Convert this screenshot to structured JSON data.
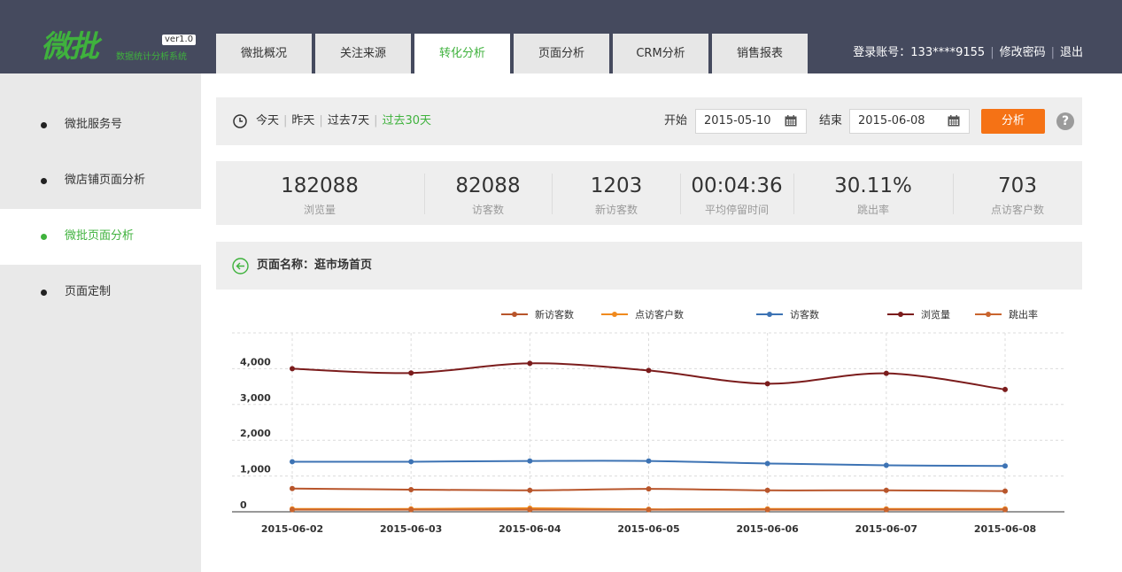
{
  "header": {
    "logo_text": "微批",
    "logo_version": "ver1.0",
    "logo_subtitle": "数据统计分析系统",
    "tabs": [
      {
        "label": "微批概况"
      },
      {
        "label": "关注来源"
      },
      {
        "label": "转化分析"
      },
      {
        "label": "页面分析"
      },
      {
        "label": "CRM分析"
      },
      {
        "label": "销售报表"
      }
    ],
    "active_tab": 2,
    "account_label": "登录账号：133****9155",
    "change_password": "修改密码",
    "logout": "退出"
  },
  "sidebar": {
    "items": [
      {
        "label": "微批服务号"
      },
      {
        "label": "微店铺页面分析"
      },
      {
        "label": "微批页面分析"
      },
      {
        "label": "页面定制"
      }
    ],
    "active_index": 2
  },
  "filter": {
    "clock_icon": "clock-icon",
    "ranges": [
      {
        "label": "今天"
      },
      {
        "label": "昨天"
      },
      {
        "label": "过去7天"
      },
      {
        "label": "过去30天"
      }
    ],
    "active_range": 3,
    "start_label": "开始",
    "start_date": "2015-05-10",
    "end_label": "结束",
    "end_date": "2015-06-08",
    "analyze_button": "分析",
    "help": "?"
  },
  "stats": [
    {
      "value": "182088",
      "label": "浏览量"
    },
    {
      "value": "82088",
      "label": "访客数"
    },
    {
      "value": "1203",
      "label": "新访客数"
    },
    {
      "value": "00:04:36",
      "label": "平均停留时间"
    },
    {
      "value": "30.11%",
      "label": "跳出率"
    },
    {
      "value": "703",
      "label": "点访客户数"
    }
  ],
  "page_bar": {
    "title": "页面名称：逛市场首页"
  },
  "colors": {
    "accent_green": "#3fb23d",
    "header_bg": "#454a5e",
    "analyze_orange": "#f57215"
  },
  "chart_data": {
    "type": "line",
    "x": [
      "2015-06-02",
      "2015-06-03",
      "2015-06-04",
      "2015-06-05",
      "2015-06-06",
      "2015-06-07",
      "2015-06-08"
    ],
    "yticks": [
      "0",
      "1,000",
      "2,000",
      "3,000",
      "4,000"
    ],
    "ylim": [
      0,
      5000
    ],
    "grid": true,
    "legend_position": "top-right",
    "series": [
      {
        "name": "新访客数",
        "color": "#b8552b",
        "values": [
          650,
          620,
          600,
          640,
          600,
          600,
          580
        ]
      },
      {
        "name": "点访客户数",
        "color": "#f08a1e",
        "values": [
          80,
          80,
          100,
          70,
          80,
          80,
          80
        ]
      },
      {
        "name": "访客数",
        "color": "#3d73b4",
        "values": [
          1400,
          1400,
          1420,
          1420,
          1350,
          1300,
          1280
        ]
      },
      {
        "name": "浏览量",
        "color": "#7b1c1c",
        "values": [
          4000,
          3880,
          4150,
          3950,
          3580,
          3870,
          3420
        ]
      },
      {
        "name": "跳出率",
        "color": "#c9642e",
        "values": [
          60,
          60,
          60,
          60,
          60,
          60,
          60
        ]
      }
    ]
  }
}
